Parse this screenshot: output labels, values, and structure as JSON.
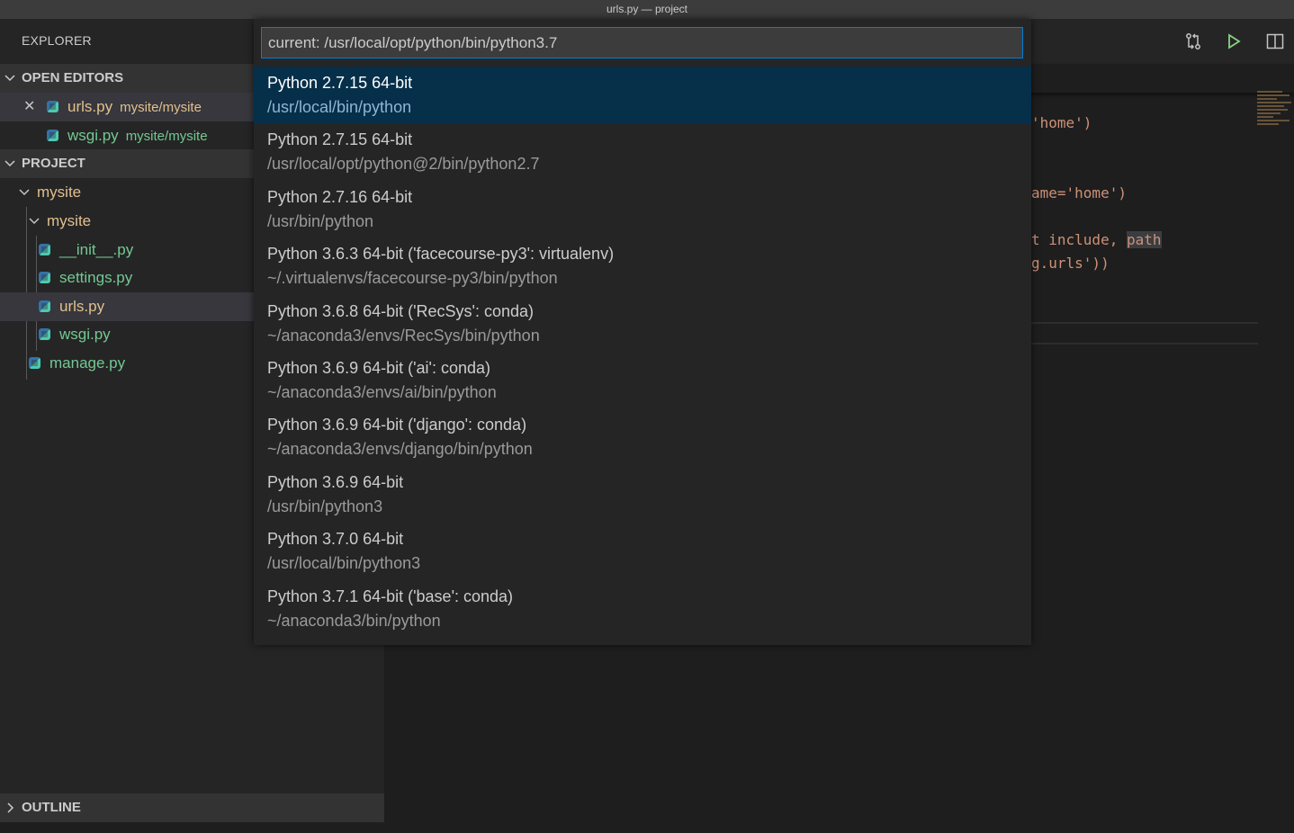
{
  "window": {
    "title": "urls.py — project"
  },
  "sidebar": {
    "title": "EXPLORER",
    "open_editors": {
      "label": "OPEN EDITORS",
      "items": [
        {
          "name": "urls.py",
          "description": "mysite/mysite"
        },
        {
          "name": "wsgi.py",
          "description": "mysite/mysite"
        }
      ]
    },
    "project": {
      "label": "PROJECT",
      "folders": [
        {
          "name": "mysite"
        },
        {
          "name": "mysite"
        }
      ],
      "files": [
        {
          "name": "__init__.py"
        },
        {
          "name": "settings.py"
        },
        {
          "name": "urls.py"
        },
        {
          "name": "wsgi.py"
        },
        {
          "name": "manage.py"
        }
      ]
    },
    "outline": {
      "label": "OUTLINE"
    }
  },
  "editor": {
    "code_fragments": [
      "'home')",
      "ame='home')",
      "t include, ",
      "path",
      "g.urls'))"
    ]
  },
  "quick_pick": {
    "input_value": "current: /usr/local/opt/python/bin/python3.7",
    "items": [
      {
        "label": "Python 2.7.15 64-bit",
        "detail": "/usr/local/bin/python"
      },
      {
        "label": "Python 2.7.15 64-bit",
        "detail": "/usr/local/opt/python@2/bin/python2.7"
      },
      {
        "label": "Python 2.7.16 64-bit",
        "detail": "/usr/bin/python"
      },
      {
        "label": "Python 3.6.3 64-bit ('facecourse-py3': virtualenv)",
        "detail": "~/.virtualenvs/facecourse-py3/bin/python"
      },
      {
        "label": "Python 3.6.8 64-bit ('RecSys': conda)",
        "detail": "~/anaconda3/envs/RecSys/bin/python"
      },
      {
        "label": "Python 3.6.9 64-bit ('ai': conda)",
        "detail": "~/anaconda3/envs/ai/bin/python"
      },
      {
        "label": "Python 3.6.9 64-bit ('django': conda)",
        "detail": "~/anaconda3/envs/django/bin/python"
      },
      {
        "label": "Python 3.6.9 64-bit",
        "detail": "/usr/bin/python3"
      },
      {
        "label": "Python 3.7.0 64-bit",
        "detail": "/usr/local/bin/python3"
      },
      {
        "label": "Python 3.7.1 64-bit ('base': conda)",
        "detail": "~/anaconda3/bin/python"
      }
    ]
  },
  "colors": {
    "accent": "#007fd4",
    "selection": "#062f4a",
    "modified_yellow": "#e2c08d",
    "untracked_green": "#73c991",
    "run_green": "#89d185"
  },
  "icons": {
    "toolbar": [
      "compare-changes-icon",
      "run-icon",
      "split-editor-icon"
    ],
    "file": "python-file-icon"
  }
}
